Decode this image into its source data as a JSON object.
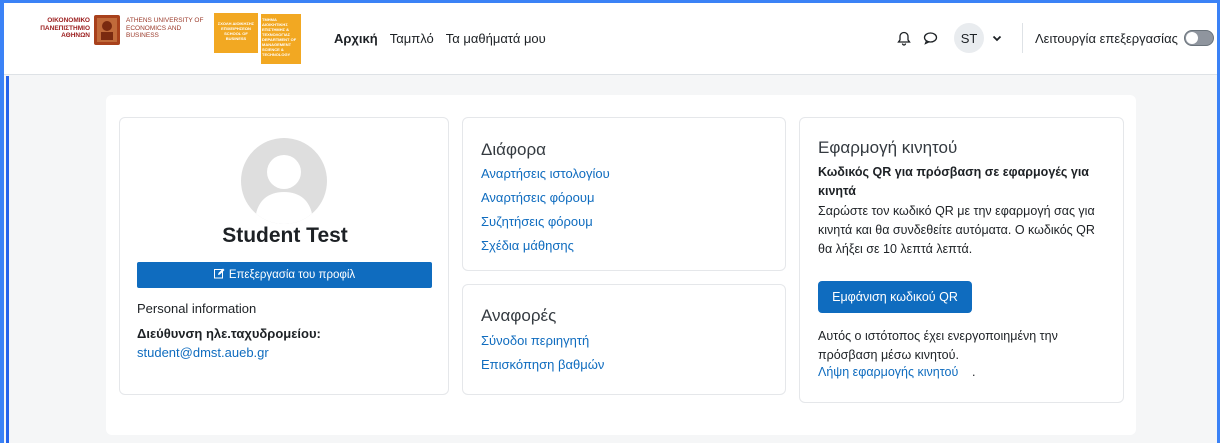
{
  "logos": {
    "aueb_greek": "ΟΙΚΟΝΟΜΙΚΟ ΠΑΝΕΠΙΣΤΗΜΙΟ ΑΘΗΝΩΝ",
    "aueb_english": "ATHENS UNIVERSITY OF ECONOMICS AND BUSINESS",
    "school_text": "ΣΧΟΛΗ ΔΙΟΙΚΗΣΗΣ ΕΠΙΧΕΙΡΗΣΕΩΝ SCHOOL OF BUSINESS",
    "dept_text": "ΤΜΗΜΑ ΔΙΟΙΚΗΤΙΚΗΣ ΕΠΙΣΤΗΜΗΣ & ΤΕΧΝΟΛΟΓΙΑΣ DEPARTMENT OF MANAGEMENT SCIENCE & TECHNOLOGY"
  },
  "nav": {
    "home": "Αρχική",
    "dashboard": "Ταμπλό",
    "my_courses": "Τα μαθήματά μου"
  },
  "user": {
    "initials": "ST",
    "edit_mode_label": "Λειτουργία επεξεργασίας"
  },
  "profile": {
    "name": "Student Test",
    "edit_button": "Επεξεργασία του προφίλ",
    "personal_info": "Personal information",
    "email_label": "Διεύθυνση ηλε.ταχυδρομείου:",
    "email_value": "student@dmst.aueb.gr"
  },
  "misc": {
    "title": "Διάφορα",
    "links": [
      "Αναρτήσεις ιστολογίου",
      "Αναρτήσεις φόρουμ",
      "Συζητήσεις φόρουμ",
      "Σχέδια μάθησης"
    ]
  },
  "reports": {
    "title": "Αναφορές",
    "links": [
      "Σύνοδοι περιηγητή",
      "Επισκόπηση βαθμών"
    ]
  },
  "mobile": {
    "title": "Εφαρμογή κινητού",
    "qr_heading": "Κωδικός QR για πρόσβαση σε εφαρμογές για κινητά",
    "qr_description": "Σαρώστε τον κωδικό QR με την εφαρμογή σας για κινητά και θα συνδεθείτε αυτόματα. Ο κωδικός QR θα λήξει σε 10 λεπτά λεπτά.",
    "qr_button": "Εμφάνιση κωδικού QR",
    "note": "Αυτός ο ιστότοπος έχει ενεργοποιημένη την πρόσβαση μέσω κινητού.",
    "get_app_link": "Λήψη εφαρμογής κινητού",
    "get_app_suffix": "."
  },
  "colors": {
    "primary": "#0f6cbf",
    "frame": "#3b82f6"
  }
}
